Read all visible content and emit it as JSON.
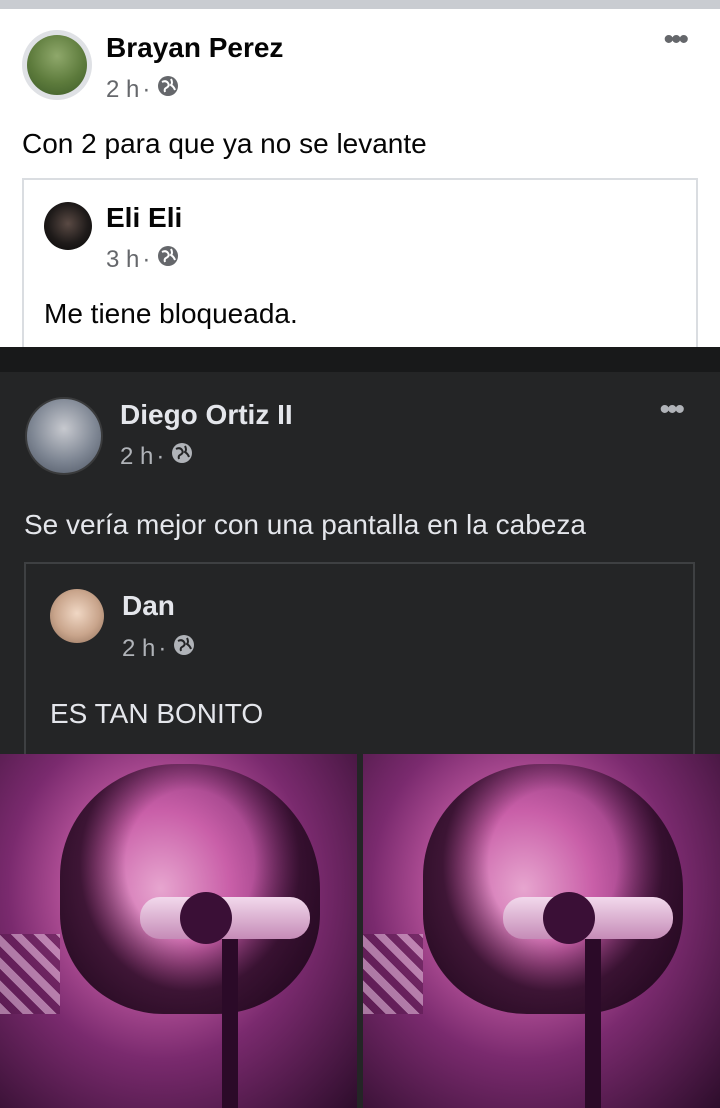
{
  "light_post": {
    "author": "Brayan Perez",
    "time": "2 h",
    "separator": "·",
    "more_label": "•••",
    "text": "Con 2 para que ya no se levante",
    "shared": {
      "author": "Eli Eli",
      "time": "3 h",
      "separator": "·",
      "text": "Me tiene bloqueada."
    }
  },
  "dark_post": {
    "author": "Diego Ortiz II",
    "time": "2 h",
    "separator": "·",
    "more_label": "•••",
    "text": "Se vería mejor con una pantalla en la cabeza",
    "shared": {
      "author": "Dan",
      "time": "2 h",
      "separator": "·",
      "text": "ES TAN BONITO"
    }
  },
  "icons": {
    "privacy": "globe-icon",
    "more": "more-options-icon"
  },
  "colors": {
    "light_bg": "#ffffff",
    "dark_bg": "#242526",
    "light_text": "#050505",
    "dark_text": "#e4e6eb",
    "light_meta": "#65676b",
    "dark_meta": "#b0b3b8",
    "photo_tint": "#c95fa8"
  }
}
